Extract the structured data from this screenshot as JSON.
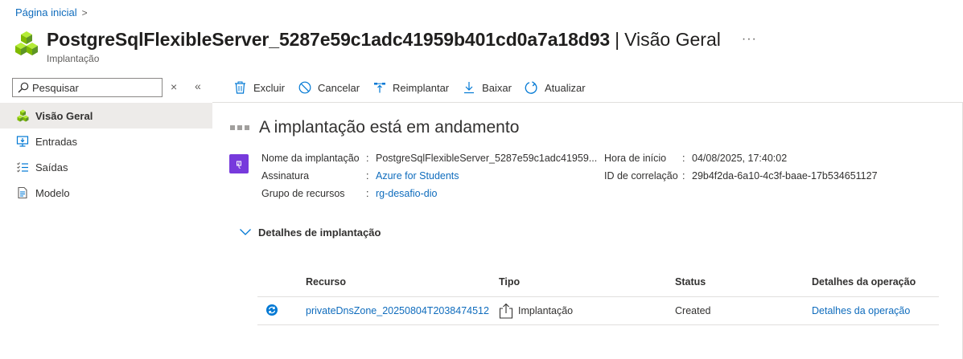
{
  "breadcrumb": {
    "home": "Página inicial",
    "separator": ">"
  },
  "header": {
    "title": "PostgreSqlFlexibleServer_5287e59c1adc41959b401cd0a7a18d93",
    "separator": "|",
    "section": "Visão Geral",
    "more": "···",
    "subtitle": "Implantação"
  },
  "search": {
    "placeholder": "Pesquisar",
    "clear": "×",
    "collapse": "«"
  },
  "sidebar": {
    "items": [
      {
        "label": "Visão Geral",
        "icon": "deployment-cubes-icon",
        "active": true
      },
      {
        "label": "Entradas",
        "icon": "inputs-monitor-icon",
        "active": false
      },
      {
        "label": "Saídas",
        "icon": "outputs-list-icon",
        "active": false
      },
      {
        "label": "Modelo",
        "icon": "template-document-icon",
        "active": false
      }
    ]
  },
  "toolbar": {
    "delete": "Excluir",
    "cancel": "Cancelar",
    "redeploy": "Reimplantar",
    "download": "Baixar",
    "refresh": "Atualizar"
  },
  "status": {
    "title": "A implantação está em andamento"
  },
  "deployment": {
    "name_label": "Nome da implantação",
    "name_value": "PostgreSqlFlexibleServer_5287e59c1adc41959...",
    "subscription_label": "Assinatura",
    "subscription_value": "Azure for Students",
    "resource_group_label": "Grupo de recursos",
    "resource_group_value": "rg-desafio-dio",
    "start_label": "Hora de início",
    "start_value": "04/08/2025, 17:40:02",
    "correlation_label": "ID de correlação",
    "correlation_value": "29b4f2da-6a10-4c3f-baae-17b534651127",
    "colon": ":"
  },
  "details": {
    "toggle_label": "Detalhes de implantação",
    "columns": {
      "resource": "Recurso",
      "type": "Tipo",
      "status": "Status",
      "op_details": "Detalhes da operação"
    },
    "rows": [
      {
        "resource": "privateDnsZone_20250804T2038474512",
        "type": "Implantação",
        "status": "Created",
        "op_details": "Detalhes da operação"
      }
    ]
  },
  "colors": {
    "accent": "#0f6cbd",
    "active_bg": "#edebe9",
    "deployment_icon": "#773adc",
    "cube_green": "#7fba00"
  }
}
